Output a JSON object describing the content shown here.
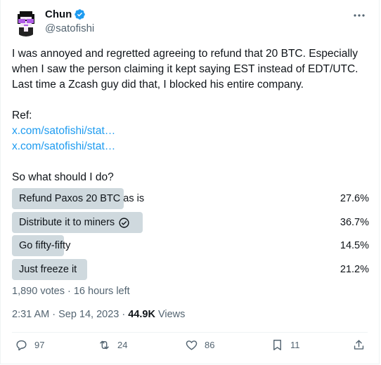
{
  "author": {
    "name": "Chun",
    "handle": "@satofishi",
    "verified": true,
    "avatar_icon": "pixel-avatar-purple-glasses"
  },
  "tweet": {
    "paragraph1": "I was annoyed and regretted agreeing to refund that 20 BTC. Especially when I saw the person claiming it kept saying EST instead of EDT/UTC. Last time a Zcash guy did that, I blocked his entire company.",
    "ref_label": "Ref:",
    "link1": "x.com/satofishi/stat…",
    "link2": "x.com/satofishi/stat…",
    "question": "So what should I do?"
  },
  "poll": {
    "options": [
      {
        "label": "Refund Paxos 20 BTC as is",
        "percent": "27.6%",
        "value": 27.6,
        "selected": false
      },
      {
        "label": "Distribute it to miners",
        "percent": "36.7%",
        "value": 36.7,
        "selected": true
      },
      {
        "label": "Go fifty-fifty",
        "percent": "14.5%",
        "value": 14.5,
        "selected": false
      },
      {
        "label": "Just freeze it",
        "percent": "21.2%",
        "value": 21.2,
        "selected": false
      }
    ],
    "meta": "1,890 votes · 16 hours left"
  },
  "timestamp": {
    "time": "2:31 AM · Sep 14, 2023 · ",
    "views_count": "44.9K",
    "views_label": " Views"
  },
  "actions": {
    "replies": "97",
    "reposts": "24",
    "likes": "86",
    "bookmarks": "11"
  },
  "colors": {
    "accent": "#1d9bf0",
    "poll_fill": "#cfd9de",
    "muted": "#536471"
  }
}
